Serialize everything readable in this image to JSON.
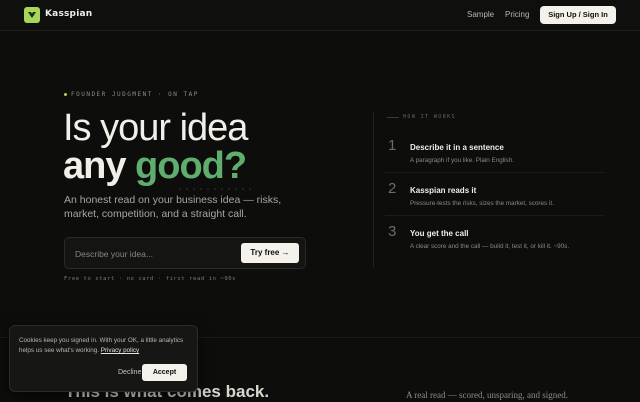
{
  "header": {
    "brand": "Kasspian",
    "nav": {
      "sample": "Sample",
      "pricing": "Pricing"
    },
    "cta": "Sign Up / Sign In"
  },
  "hero": {
    "eyebrow": "FOUNDER JUDGMENT · ON TAP",
    "headline_line1": "Is your idea",
    "headline_line2_prefix": "any ",
    "headline_line2_accent": "good?",
    "subtitle": "An honest read on your business idea — risks, market, competition, and a straight call.",
    "search": {
      "placeholder": "Describe your idea...",
      "button": "Try free →"
    },
    "fine_print": "Free to start · no card · first read in ~90s"
  },
  "how_it_works": {
    "title": "HOW IT WORKS",
    "steps": [
      {
        "num": "1",
        "title": "Describe it in a sentence",
        "desc": "A paragraph if you like. Plain English."
      },
      {
        "num": "2",
        "title": "Kasspian reads it",
        "desc": "Pressure-tests the risks, sizes the market, scores it."
      },
      {
        "num": "3",
        "title": "You get the call",
        "desc": "A clear score and the call — build it, test it, or kill it. ~90s."
      }
    ]
  },
  "bottom": {
    "heading": "This is what comes back.",
    "note": "A real read — scored, unsparing, and signed."
  },
  "cookie": {
    "text": "Cookies keep you signed in. With your OK, a little analytics helps us see what's working.",
    "link": "Privacy policy",
    "decline": "Decline",
    "accept": "Accept"
  },
  "colors": {
    "accent_green": "#5fae6e",
    "logo_green": "#a6d65a",
    "background": "#0d0d0c"
  }
}
